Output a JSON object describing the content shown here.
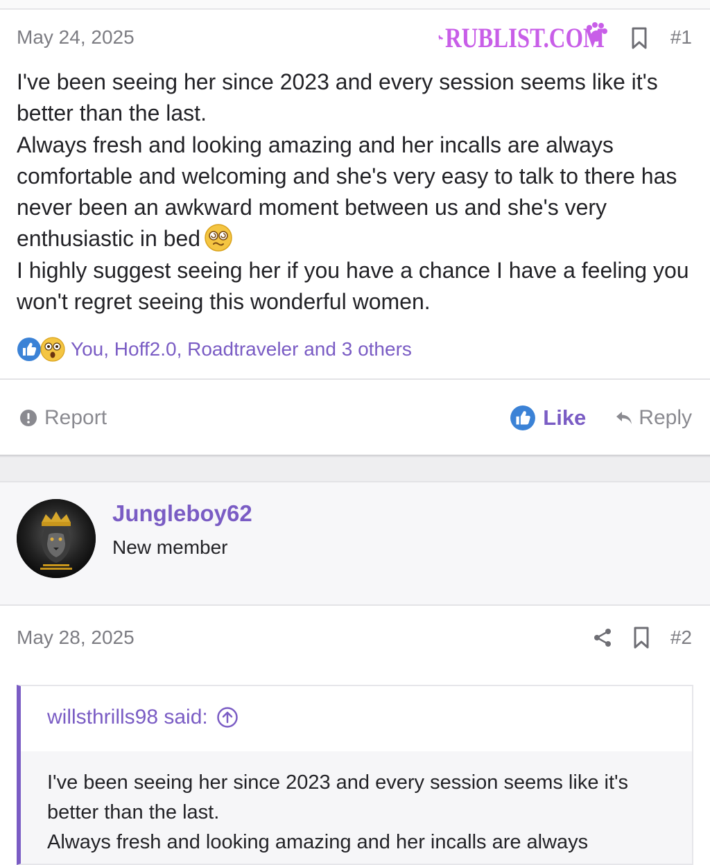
{
  "watermark": {
    "text": "RUBLIST.COM",
    "color": "#c85ee8"
  },
  "post1": {
    "date": "May 24, 2025",
    "number": "#1",
    "body_lines": [
      "I've been seeing her since 2023 and every session seems like it's better than the last.",
      "Always fresh and looking amazing and her incalls are always comfortable and welcoming and she's very easy to talk to there has never been an awkward moment between us and she's very enthusiastic in bed",
      "I highly suggest seeing her if you have a chance I have a feeling you won't regret seeing this wonderful women."
    ],
    "emoji_icon": "dizzy-face-emoji-icon",
    "reactions": {
      "icons": [
        "thumbs-up-icon",
        "astonished-face-icon"
      ],
      "text": "You, Hoff2.0, Roadtraveler and 3 others"
    },
    "footer": {
      "report_label": "Report",
      "like_label": "Like",
      "reply_label": "Reply"
    }
  },
  "post2": {
    "user": {
      "username": "Jungleboy62",
      "title": "New member",
      "avatar_icon": "crowned-lion-avatar"
    },
    "date": "May 28, 2025",
    "number": "#2",
    "quote": {
      "author_label": "willsthrills98 said:",
      "lines": [
        "I've been seeing her since 2023 and every session seems like it's better than the last.",
        "Always fresh and looking amazing and her incalls are always"
      ]
    }
  },
  "colors": {
    "accent": "#7a5cc4",
    "muted_text": "#7c7c82",
    "like_blue": "#3b82d6"
  }
}
